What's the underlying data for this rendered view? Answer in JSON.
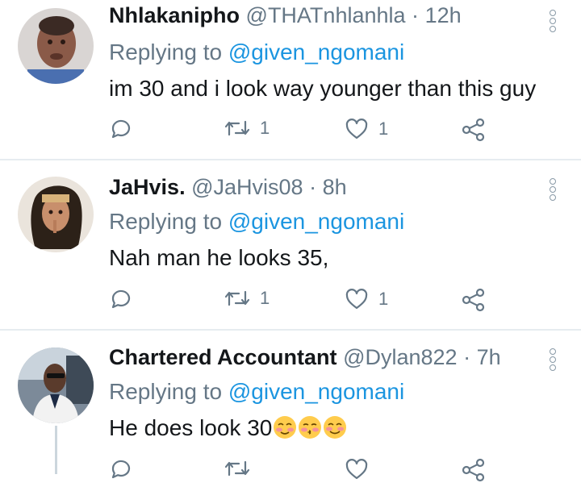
{
  "tweets": [
    {
      "name": "Nhlakanipho",
      "handle": "@THATnhlanhla",
      "dot": "·",
      "time": "12h",
      "replying_prefix": "Replying to",
      "replying_to": "@given_ngomani",
      "text": "im 30 and i look way younger than this guy",
      "retweets": "1",
      "likes": "1"
    },
    {
      "name": "JaHvis.",
      "handle": "@JaHvis08",
      "dot": "·",
      "time": "8h",
      "replying_prefix": "Replying to",
      "replying_to": "@given_ngomani",
      "text": "Nah man he looks 35,",
      "retweets": "1",
      "likes": "1"
    },
    {
      "name": "Chartered Accountant",
      "handle": "@Dylan822",
      "dot": "·",
      "time": "7h",
      "replying_prefix": "Replying to",
      "replying_to": "@given_ngomani",
      "text": "He does look 30",
      "emojis": [
        "smiling-face-with-blush-icon",
        "kissing-face-icon",
        "blushing-face-icon"
      ]
    }
  ],
  "colors": {
    "name": "#14171a",
    "secondary": "#657786",
    "mention": "#1b95e0",
    "divider": "#e6ecf0"
  }
}
